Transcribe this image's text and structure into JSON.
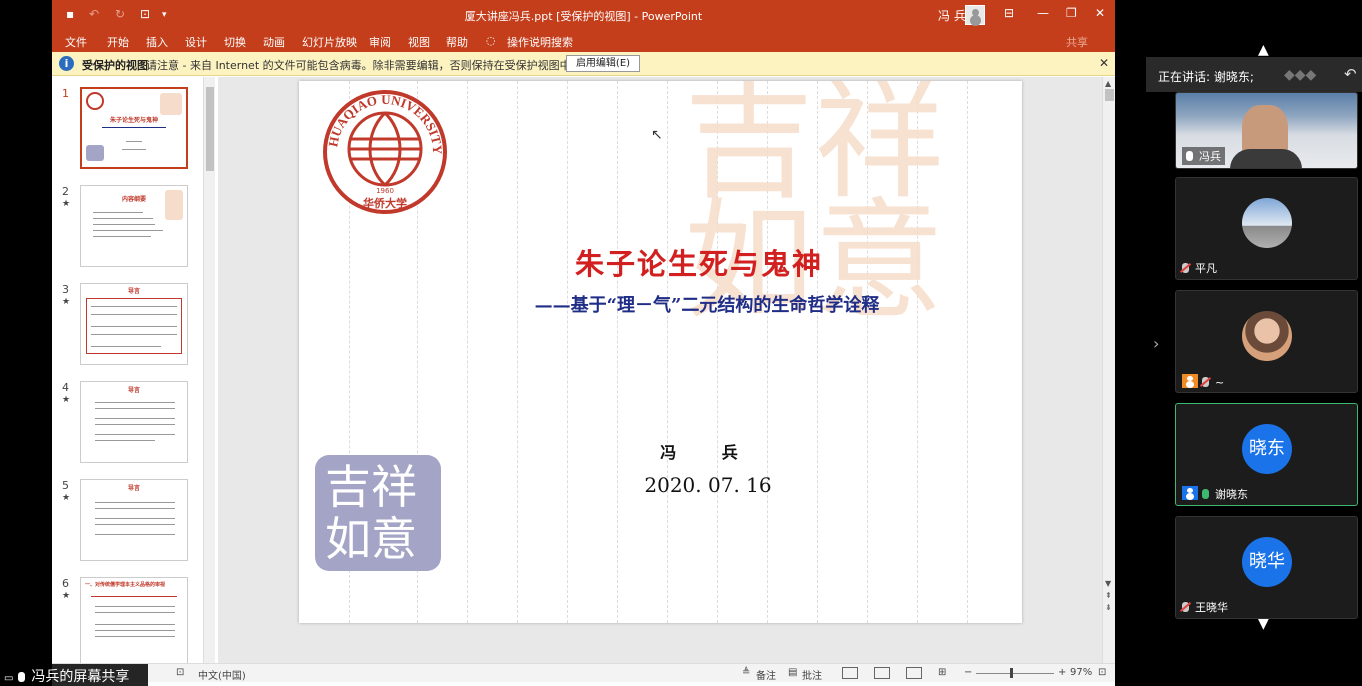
{
  "window": {
    "doc_title": "厦大讲座冯兵.ppt [受保护的视图]  -  PowerPoint",
    "user": "冯 兵"
  },
  "ribbon": {
    "tabs": [
      "文件",
      "开始",
      "插入",
      "设计",
      "切换",
      "动画",
      "幻灯片放映",
      "审阅",
      "视图",
      "帮助",
      "操作说明搜索"
    ],
    "share": "共享"
  },
  "protected_bar": {
    "title": "受保护的视图",
    "message": "请注意 - 来自 Internet 的文件可能包含病毒。除非需要编辑，否则保持在受保护视图中比较安全。",
    "button": "启用编辑(E)"
  },
  "thumbnails": [
    {
      "num": "1",
      "star": "",
      "title": "朱子论生死与鬼神"
    },
    {
      "num": "2",
      "star": "★",
      "title": "内容纲要"
    },
    {
      "num": "3",
      "star": "★",
      "title": "导言"
    },
    {
      "num": "4",
      "star": "★",
      "title": "导言"
    },
    {
      "num": "5",
      "star": "★",
      "title": "导言"
    },
    {
      "num": "6",
      "star": "★",
      "title": "一、对传统儒学理本主义品格的审视"
    }
  ],
  "slide": {
    "logo_text": "HUAQIAO UNIVERSITY",
    "logo_year": "1960",
    "logo_cn": "华侨大学",
    "big_seal": "吉祥如意",
    "small_seal": "吉祥如意",
    "title": "朱子论生死与鬼神",
    "subtitle": "——基于“理－气”二元结构的生命哲学诠释",
    "author": "冯 兵",
    "date": "2020. 07. 16"
  },
  "status": {
    "language": "中文(中国)",
    "notes": "备注",
    "comments": "批注",
    "zoom": "97%"
  },
  "share_label": "冯兵的屏幕共享",
  "meeting": {
    "speaking": "正在讲话: 谢晓东;",
    "participants": [
      {
        "name": "冯兵",
        "type": "video",
        "mic": "on",
        "active": false
      },
      {
        "name": "平凡",
        "type": "photo",
        "mic": "off",
        "active": false
      },
      {
        "name": "~",
        "type": "photo",
        "mic": "off",
        "active": false
      },
      {
        "name": "谢晓东",
        "type": "circle",
        "avatar_text": "晓东",
        "mic": "on",
        "active": true
      },
      {
        "name": "王晓华",
        "type": "circle",
        "avatar_text": "晓华",
        "mic": "off",
        "active": false
      }
    ]
  },
  "colors": {
    "ppt_accent": "#c43e1c",
    "title_red": "#d21f1f",
    "subtitle_blue": "#1f2d86",
    "active_green": "#3fb870",
    "avatar_blue": "#1a73e8"
  }
}
